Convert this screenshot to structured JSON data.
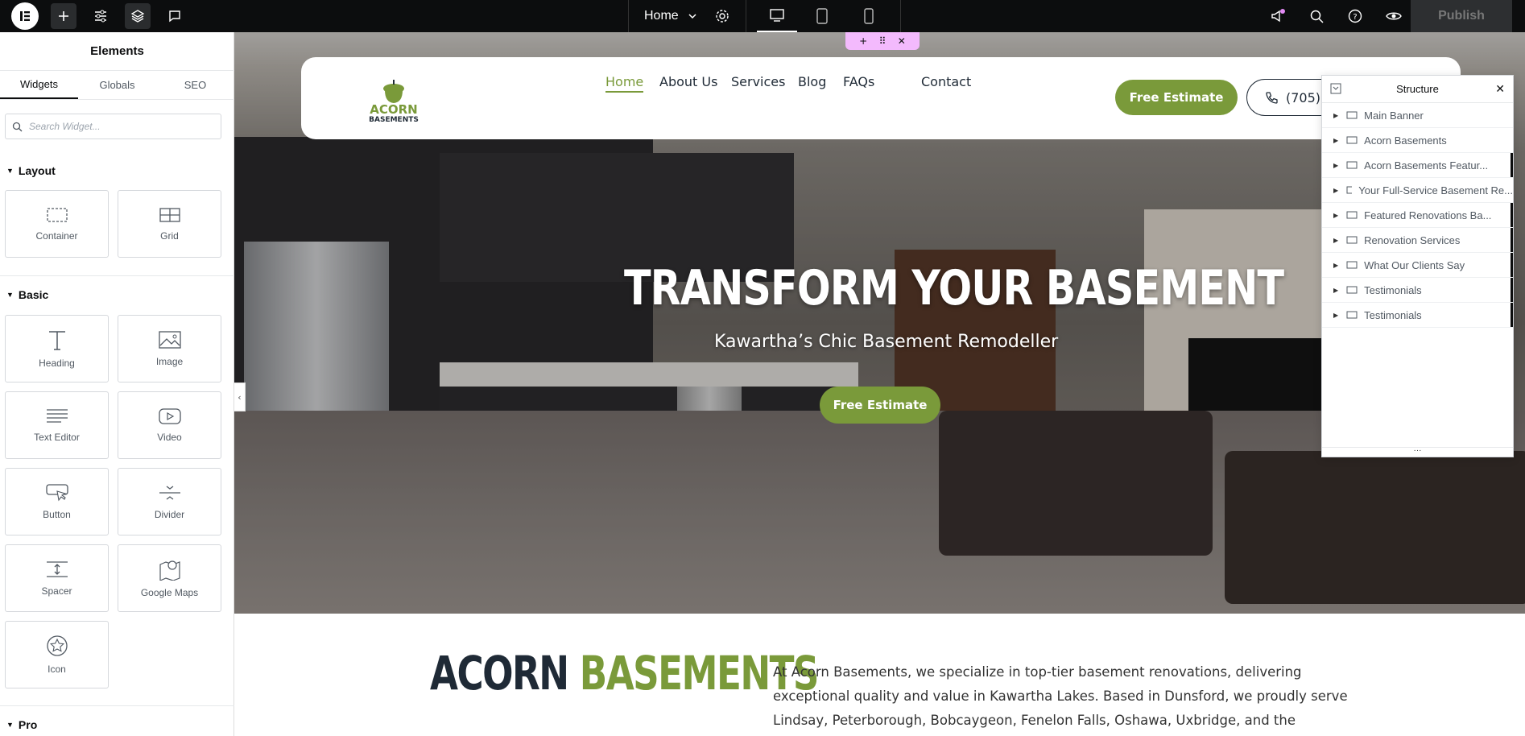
{
  "topbar": {
    "page_selector": "Home",
    "publish_label": "Publish"
  },
  "left_panel": {
    "title": "Elements",
    "tabs": [
      "Widgets",
      "Globals",
      "SEO"
    ],
    "search_placeholder": "Search Widget...",
    "sections": {
      "layout": {
        "label": "Layout",
        "widgets": [
          "Container",
          "Grid"
        ]
      },
      "basic": {
        "label": "Basic",
        "widgets": [
          "Heading",
          "Image",
          "Text Editor",
          "Video",
          "Button",
          "Divider",
          "Spacer",
          "Google Maps",
          "Icon"
        ]
      },
      "pro": {
        "label": "Pro"
      }
    }
  },
  "site": {
    "logo_text_top": "ACORN",
    "logo_text_bottom": "BASEMENTS",
    "nav": [
      "Home",
      "About Us",
      "Services",
      "Blog",
      "FAQs",
      "Contact"
    ],
    "header_cta": "Free Estimate",
    "phone": "(705)",
    "hero_title": "TRANSFORM YOUR BASEMENT",
    "hero_subtitle": "Kawartha’s Chic Basement Remodeller",
    "hero_cta": "Free Estimate",
    "about_title_1": "ACORN",
    "about_title_2": "BASEMENTS",
    "about_text": "At Acorn Basements, we specialize in top-tier basement renovations, delivering exceptional quality and value in Kawartha Lakes. Based in Dunsford, we proudly serve Lindsay, Peterborough, Bobcaygeon, Fenelon Falls, Oshawa, Uxbridge, and the"
  },
  "structure": {
    "title": "Structure",
    "items": [
      "Main Banner",
      "Acorn Basements",
      "Acorn Basements Featur...",
      "Your Full-Service Basement Re...",
      "Featured Renovations Ba...",
      "Renovation Services",
      "What Our Clients Say",
      "Testimonials",
      "Testimonials"
    ]
  },
  "colors": {
    "brand_green": "#7a9a3a",
    "dark_navy": "#1f2a36",
    "editor_handle": "#f3bafd",
    "topbar_bg": "#0c0d0e"
  }
}
